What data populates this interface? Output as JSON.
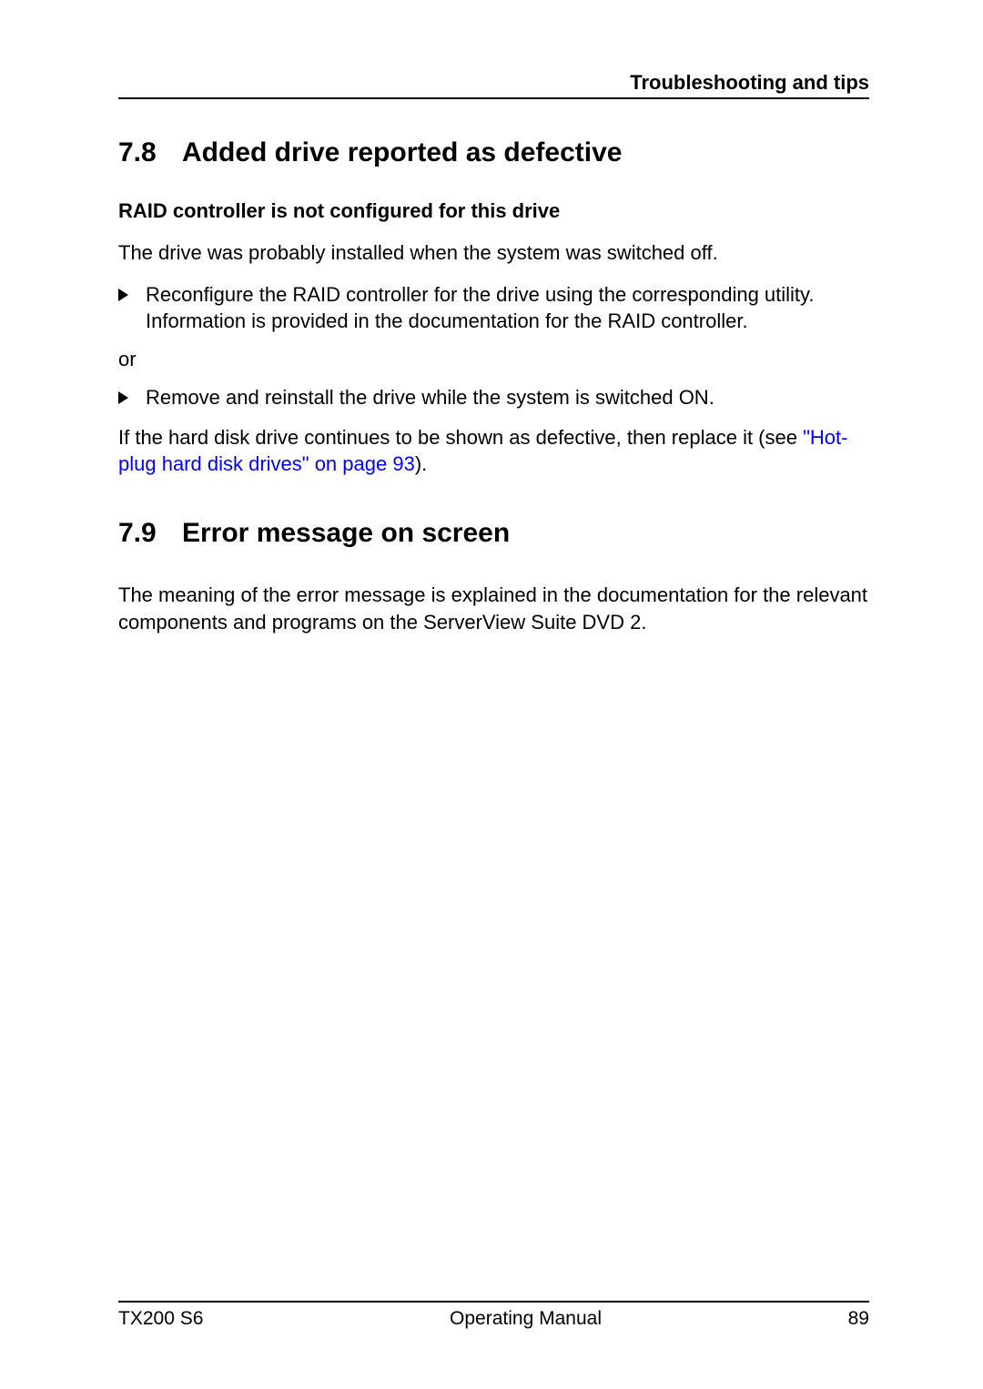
{
  "header": {
    "title": "Troubleshooting and tips"
  },
  "section_78": {
    "number": "7.8",
    "title": "Added drive reported as defective",
    "subheading": "RAID controller is not configured for this drive",
    "intro": "The drive was probably installed when the system was switched off.",
    "bullets": [
      "Reconfigure the RAID controller for the drive using the corresponding utility. Information is provided in the documentation for the RAID controller."
    ],
    "or": "or",
    "bullets2": [
      "Remove and reinstall the drive while the system is switched ON."
    ],
    "closing_prefix": "If the hard disk drive continues to be shown as defective, then replace it (see ",
    "closing_link": "\"Hot-plug hard disk drives\" on page 93",
    "closing_suffix": ")."
  },
  "section_79": {
    "number": "7.9",
    "title": "Error message on screen",
    "body": "The meaning of the error message is explained in the documentation for the relevant components and programs on the ServerView Suite DVD 2."
  },
  "footer": {
    "left": "TX200 S6",
    "center": "Operating Manual",
    "right": "89"
  }
}
